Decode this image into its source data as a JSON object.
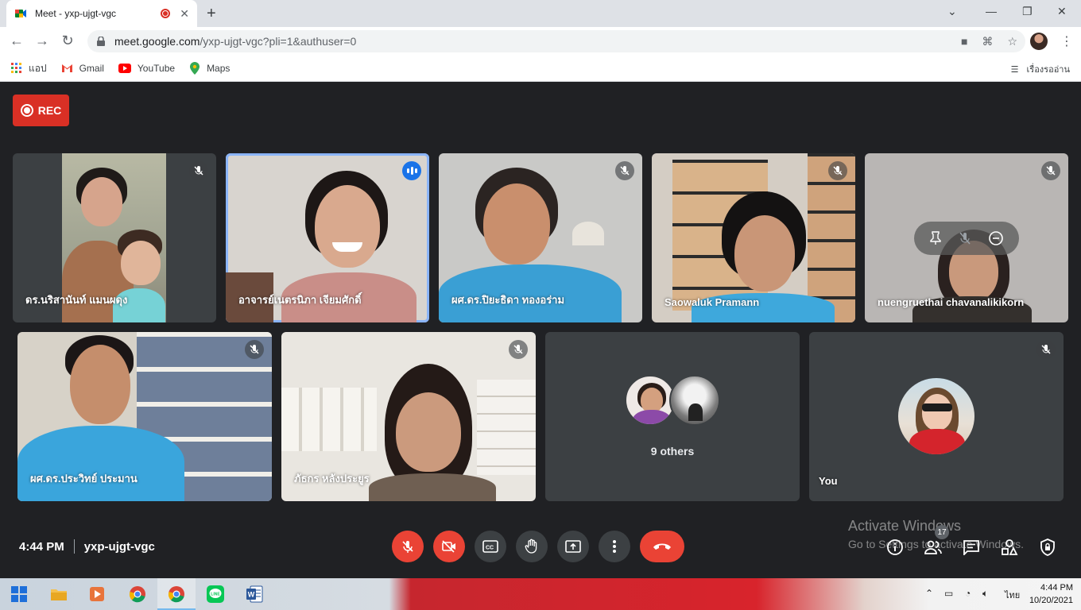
{
  "browser": {
    "tab_title": "Meet - yxp-ujgt-vgc",
    "url_main": "meet.google.com",
    "url_rest": "/yxp-ujgt-vgc?pli=1&authuser=0",
    "bookmarks": [
      "แอป",
      "Gmail",
      "YouTube",
      "Maps"
    ],
    "reading_list": "เรื่องรออ่าน"
  },
  "meet": {
    "rec_label": "REC",
    "participants": [
      "ดร.นริสานันท์ แมนผดุง",
      "อาจารย์เนตรนิภา เจียมศักดิ์",
      "ผศ.ดร.ปิยะธิดา ทองอร่าม",
      "Saowaluk Pramann",
      "nuengruethai chavanalikikorn",
      "ผศ.ดร.ประวิทย์ ประมาน",
      "ภัธกร หลังประยูร"
    ],
    "others_label": "9 others",
    "you_label": "You",
    "time": "4:44 PM",
    "meeting_code": "yxp-ujgt-vgc",
    "people_count": "17",
    "activate_line1": "Activate Windows",
    "activate_line2": "Go to Settings to activate Windows.",
    "icons": [
      "mic-off-icon",
      "camera-off-icon",
      "captions-icon",
      "raise-hand-icon",
      "present-icon",
      "more-options-icon",
      "leave-call-icon",
      "info-icon",
      "people-icon",
      "chat-icon",
      "activities-icon",
      "host-controls-icon"
    ]
  },
  "taskbar": {
    "lang": "ไทย",
    "clock_time": "4:44 PM",
    "clock_date": "10/20/2021"
  }
}
